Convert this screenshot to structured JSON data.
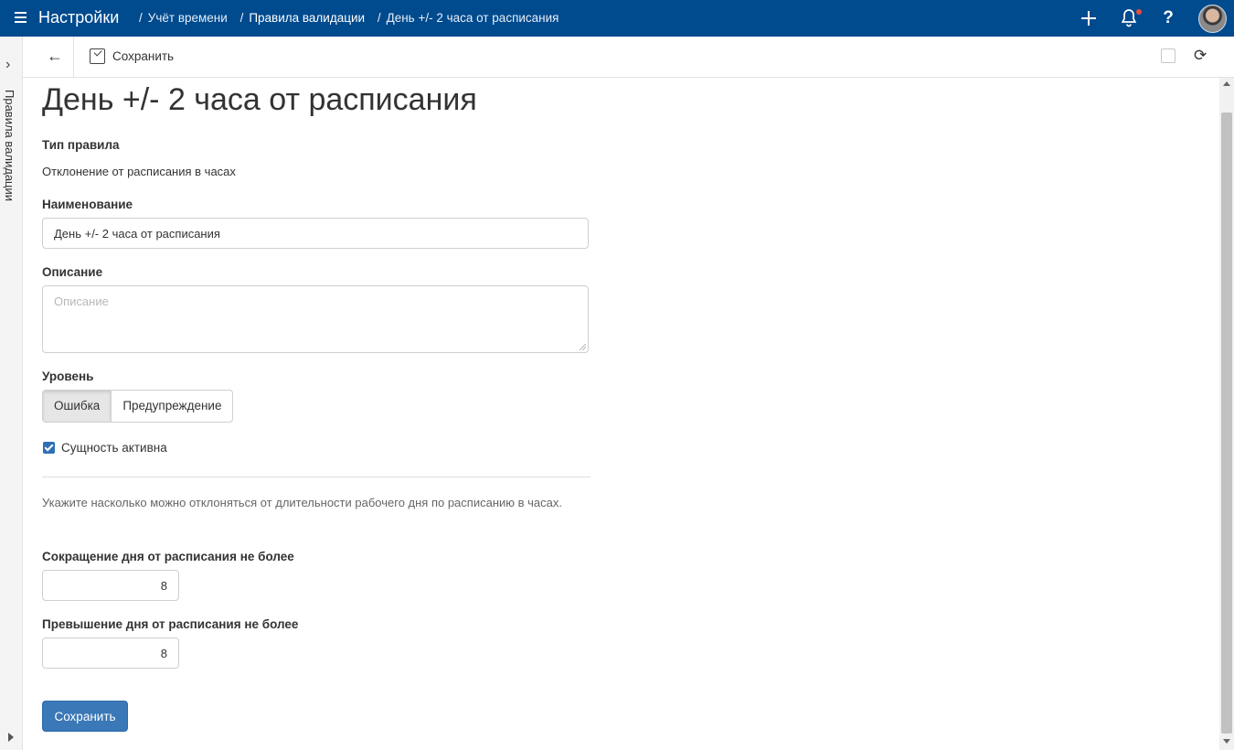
{
  "header": {
    "app_title": "Настройки",
    "breadcrumbs": [
      {
        "label": "Учёт времени"
      },
      {
        "label": "Правила валидации"
      },
      {
        "label": "День +/- 2 часа от расписания"
      }
    ],
    "help_label": "?",
    "icons": [
      "menu-icon",
      "plus-icon",
      "bell-icon",
      "help-icon",
      "avatar"
    ],
    "accent_color": "#004a8e",
    "notification_dot_color": "#e74c3c"
  },
  "sidebar": {
    "label": "Правила валидации",
    "expand_icon": "chevron-right-icon"
  },
  "toolbar": {
    "back_icon": "arrow-left-icon",
    "back_symbol": "←",
    "save_label": "Сохранить",
    "refresh_symbol": "⟳"
  },
  "form": {
    "page_title": "День +/- 2 часа от расписания",
    "rule_type_label": "Тип правила",
    "rule_type_value": "Отклонение от расписания в часах",
    "name_label": "Наименование",
    "name_value": "День +/- 2 часа от расписания",
    "description_label": "Описание",
    "description_placeholder": "Описание",
    "level_label": "Уровень",
    "level_options": [
      "Ошибка",
      "Предупреждение"
    ],
    "level_selected": "Ошибка",
    "active_label": "Сущность активна",
    "active_checked": true,
    "hint_text": "Укажите насколько можно отклоняться от длительности рабочего дня по расписанию в часах.",
    "reduction_label": "Сокращение дня от расписания не более",
    "reduction_value": "8",
    "excess_label": "Превышение дня от расписания не более",
    "excess_value": "8",
    "submit_label": "Сохранить",
    "submit_color": "#3a78b8"
  }
}
